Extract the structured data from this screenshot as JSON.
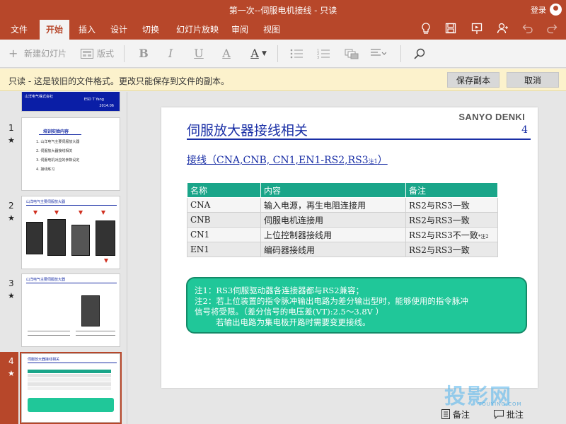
{
  "window": {
    "title": "第一次--伺服电机接线 - 只读",
    "login": "登录"
  },
  "ribbon_tabs": [
    {
      "label": "文件",
      "active": false
    },
    {
      "label": "开始",
      "active": true
    },
    {
      "label": "插入",
      "active": false
    },
    {
      "label": "设计",
      "active": false
    },
    {
      "label": "切换",
      "active": false
    },
    {
      "label": "幻灯片放映",
      "active": false
    },
    {
      "label": "审阅",
      "active": false
    },
    {
      "label": "视图",
      "active": false
    }
  ],
  "ribbon_icons": [
    "lightbulb-icon",
    "save-icon",
    "present-icon",
    "share-person-icon",
    "undo-icon",
    "redo-icon"
  ],
  "toolbar": {
    "new_slide": "新建幻灯片",
    "layout": "版式",
    "bold": "B",
    "italic": "I",
    "underline": "U",
    "font_color_a": "A",
    "font_color_a2": "A"
  },
  "readonly_bar": {
    "message": "只读 - 这是较旧的文件格式。更改只能保存到文件的副本。",
    "save_copy": "保存副本",
    "cancel": "取消"
  },
  "thumbnails": [
    {
      "number": "1",
      "star": "★",
      "cover_company": "山洋电气株式会社",
      "cover_right": "ESD T   Yang",
      "cover_date": "2014.06",
      "title": "培训实验内容",
      "items": [
        "1. 山洋电气主要伺服放大器",
        "2. 伺服放大器接线相关",
        "3. 伺服电机对应的参数设定",
        "4. 接线练习"
      ]
    },
    {
      "number": "2",
      "star": "★",
      "title": "山洋电气主要伺服放大器"
    },
    {
      "number": "3",
      "star": "★",
      "title": "山洋电气主要伺服放大器"
    },
    {
      "number": "4",
      "star": "★",
      "title": "伺服放大器接线相关",
      "selected": true
    }
  ],
  "slide": {
    "title": "伺服放大器接线相关",
    "brand": "SANYO DENKI",
    "page_number": "4",
    "subtitle": "接线（CNA,CNB,  CN1,EN1-RS2,RS3",
    "subtitle_note": "注1",
    "subtitle_end": "）",
    "table": {
      "headers": [
        "名称",
        "内容",
        "备注"
      ],
      "rows": [
        [
          "CNA",
          "输入电源，再生电阻连接用",
          "RS2与RS3一致"
        ],
        [
          "CNB",
          "伺服电机连接用",
          "RS2与RS3一致"
        ],
        [
          "CN1",
          "上位控制器接线用",
          "RS2与RS3不一致"
        ],
        [
          "EN1",
          "编码器接线用",
          "RS2与RS3一致"
        ]
      ],
      "cn1_note": "*注2"
    },
    "notes": [
      "注1：RS3伺服驱动器各连接器都与RS2兼容；",
      "注2：若上位装置的指令脉冲输出电路为差分输出型时，能够使用的指令脉冲",
      "信号将受限。（差分信号的电压差(VT):2.5～3.8V ）",
      "若输出电路为集电极开路时需要变更接线。"
    ]
  },
  "bottom": {
    "notes_label": "备注",
    "comments_label": "批注"
  },
  "watermark": {
    "text": "投影网",
    "sub": "TOUYING.COM"
  },
  "colors": {
    "accent": "#b7472a",
    "slide_blue": "#1a2fa6",
    "table_header": "#1aa589",
    "notebox": "#20c799"
  }
}
